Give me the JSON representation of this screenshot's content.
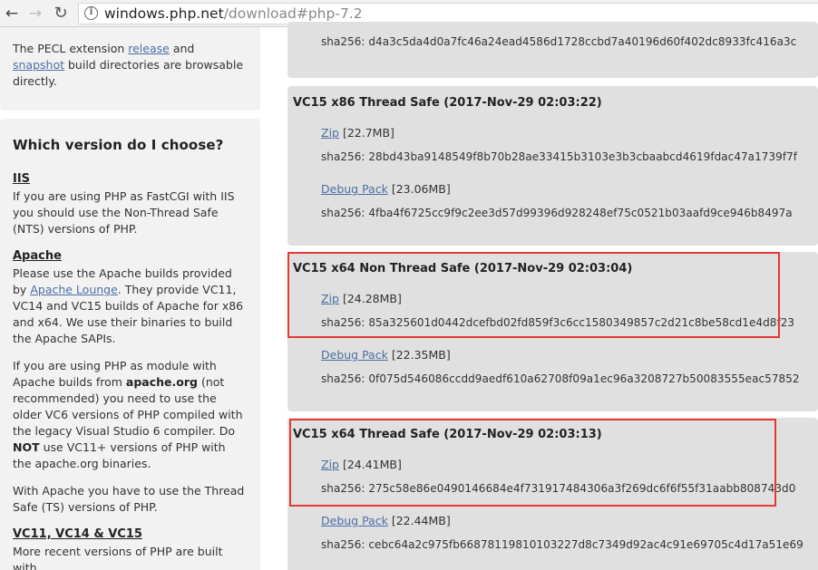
{
  "browser": {
    "url_host": "windows.php.net",
    "url_path": "/download#php-7.2"
  },
  "sidebar": {
    "pecl": {
      "text1": "The PECL extension",
      "release": "release",
      "and": "and",
      "snapshot": "snapshot",
      "text2": "build directories are browsable directly."
    },
    "choose": {
      "title": "Which version do I choose?",
      "iis_title": "IIS",
      "iis_text": "If you are using PHP as FastCGI with IIS you should use the Non-Thread Safe (NTS) versions of PHP.",
      "apache_title": "Apache",
      "apache_text1": "Please use the Apache builds provided by",
      "apache_lounge": "Apache Lounge",
      "apache_text2": ". They provide VC11, VC14 and VC15 builds of Apache for x86 and x64. We use their binaries to build the Apache SAPIs.",
      "module_text1": "If you are using PHP as module with Apache builds from",
      "module_bold": "apache.org",
      "module_text2": "(not recommended) you need to use the older VC6 versions of PHP compiled with the legacy Visual Studio 6 compiler. Do",
      "module_not": "NOT",
      "module_text3": "use VC11+ versions of PHP with the apache.org binaries.",
      "ts_text": "With Apache you have to use the Thread Safe (TS) versions of PHP.",
      "vc_title": "VC11, VC14 & VC15",
      "vc_text": "More recent versions of PHP are built with"
    }
  },
  "downloads": {
    "top_sha": "sha256: d4a3c5da4d0a7fc46a24ead4586d1728ccbd7a40196d60f402dc8933fc416a3c",
    "sections": [
      {
        "title": "VC15 x86 Thread Safe (2017-Nov-29 02:03:22)",
        "zip_label": "Zip",
        "zip_size": "[22.7MB]",
        "zip_sha": "sha256: 28bd43ba9148549f8b70b28ae33415b3103e3b3cbaabcd4619fdac47a1739f7f",
        "debug_label": "Debug Pack",
        "debug_size": "[23.06MB]",
        "debug_sha": "sha256: 4fba4f6725cc9f9c2ee3d57d99396d928248ef75c0521b03aafd9ce946b8497a"
      },
      {
        "title": "VC15 x64 Non Thread Safe (2017-Nov-29 02:03:04)",
        "zip_label": "Zip",
        "zip_size": "[24.28MB]",
        "zip_sha": "sha256: 85a325601d0442dcefbd02fd859f3c6cc1580349857c2d21c8be58cd1e4d8f23",
        "debug_label": "Debug Pack",
        "debug_size": "[22.35MB]",
        "debug_sha": "sha256: 0f075d546086ccdd9aedf610a62708f09a1ec96a3208727b50083555eac57852"
      },
      {
        "title": "VC15 x64 Thread Safe (2017-Nov-29 02:03:13)",
        "zip_label": "Zip",
        "zip_size": "[24.41MB]",
        "zip_sha": "sha256: 275c58e86e0490146684e4f731917484306a3f269dc6f6f55f31aabb808743d0",
        "debug_label": "Debug Pack",
        "debug_size": "[22.44MB]",
        "debug_sha": "sha256: cebc64a2c975fb66878119810103227d8c7349d92ac4c91e69705c4d17a51e69"
      }
    ]
  },
  "colors": {
    "highlight": "#e53935",
    "link": "#4a6fa5",
    "panel_bg": "#e0e0e0",
    "sidebar_bg": "#f2f2f2"
  }
}
